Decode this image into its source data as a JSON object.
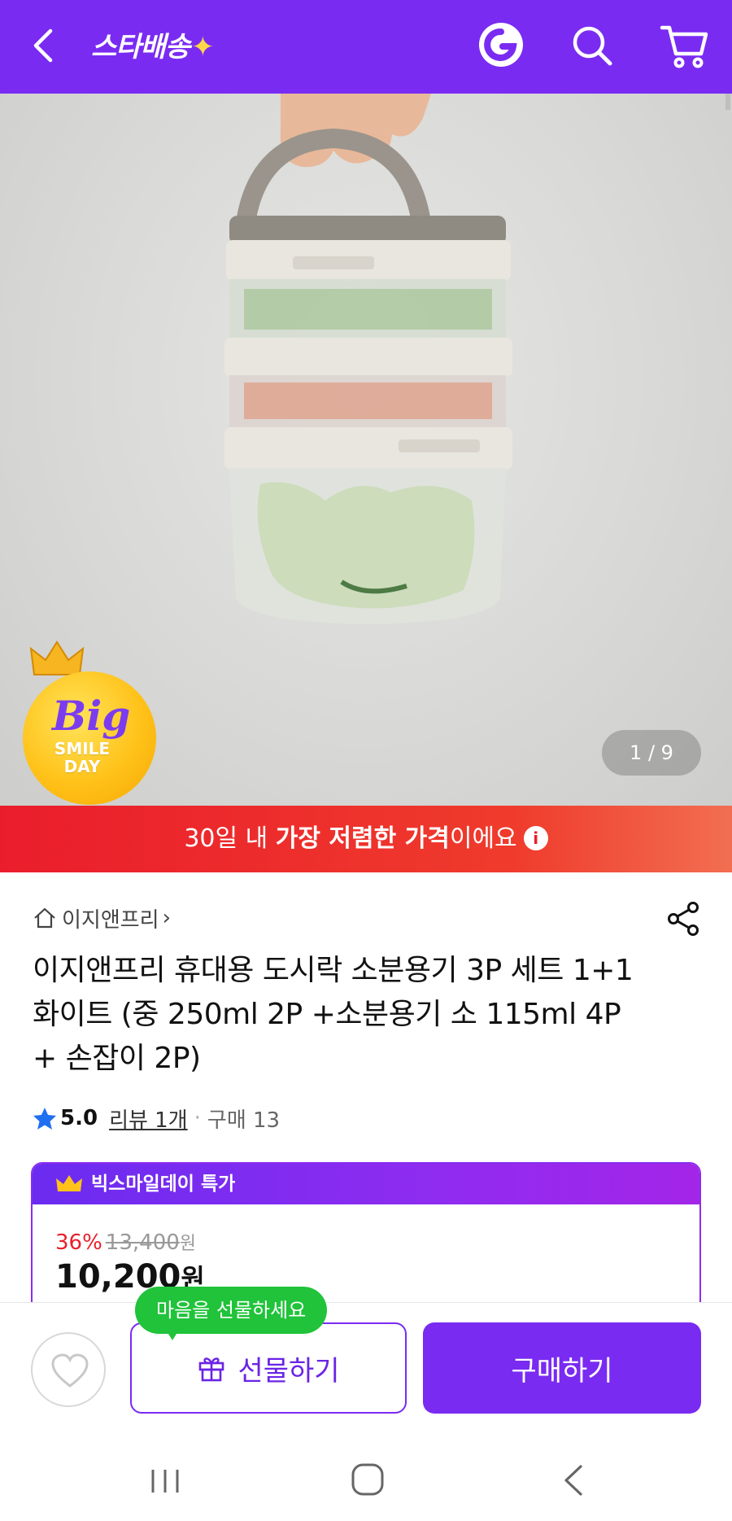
{
  "header": {
    "logo": "스타배송",
    "logo_sparkle": "✦",
    "bg_color": "#7a2bf2",
    "icons": [
      "back-icon",
      "g-logo-icon",
      "search-icon",
      "cart-icon"
    ]
  },
  "gallery": {
    "counter": "1 / 9",
    "badge": {
      "big": "Big",
      "line1": "SMILE",
      "line2": "DAY"
    }
  },
  "banner": {
    "prefix": "30일 내 ",
    "bold": "가장 저렴한 가격",
    "suffix": "이에요",
    "info_symbol": "i"
  },
  "product": {
    "store_name": "이지앤프리",
    "store_chevron": "›",
    "title": "이지앤프리 휴대용 도시락 소분용기 3P 세트 1+1 화이트 (중 250ml 2P +소분용기 소 115ml 4P + 손잡이 2P)",
    "rating": "5.0",
    "review_link": "리뷰 1개",
    "separator": "·",
    "purchase_count": "구매 13"
  },
  "deal": {
    "header": "빅스마일데이 특가",
    "discount_percent": "36%",
    "original_price": "13,400",
    "original_unit": "원",
    "sale_price": "10,200",
    "sale_unit": "원"
  },
  "actions": {
    "gift_tooltip": "마음을 선물하세요",
    "gift_label": "선물하기",
    "buy_label": "구매하기",
    "accent_color": "#7a2bf2",
    "tooltip_color": "#20c33a"
  },
  "system_nav": {
    "icons": [
      "recents-icon",
      "home-icon",
      "back-nav-icon"
    ]
  }
}
